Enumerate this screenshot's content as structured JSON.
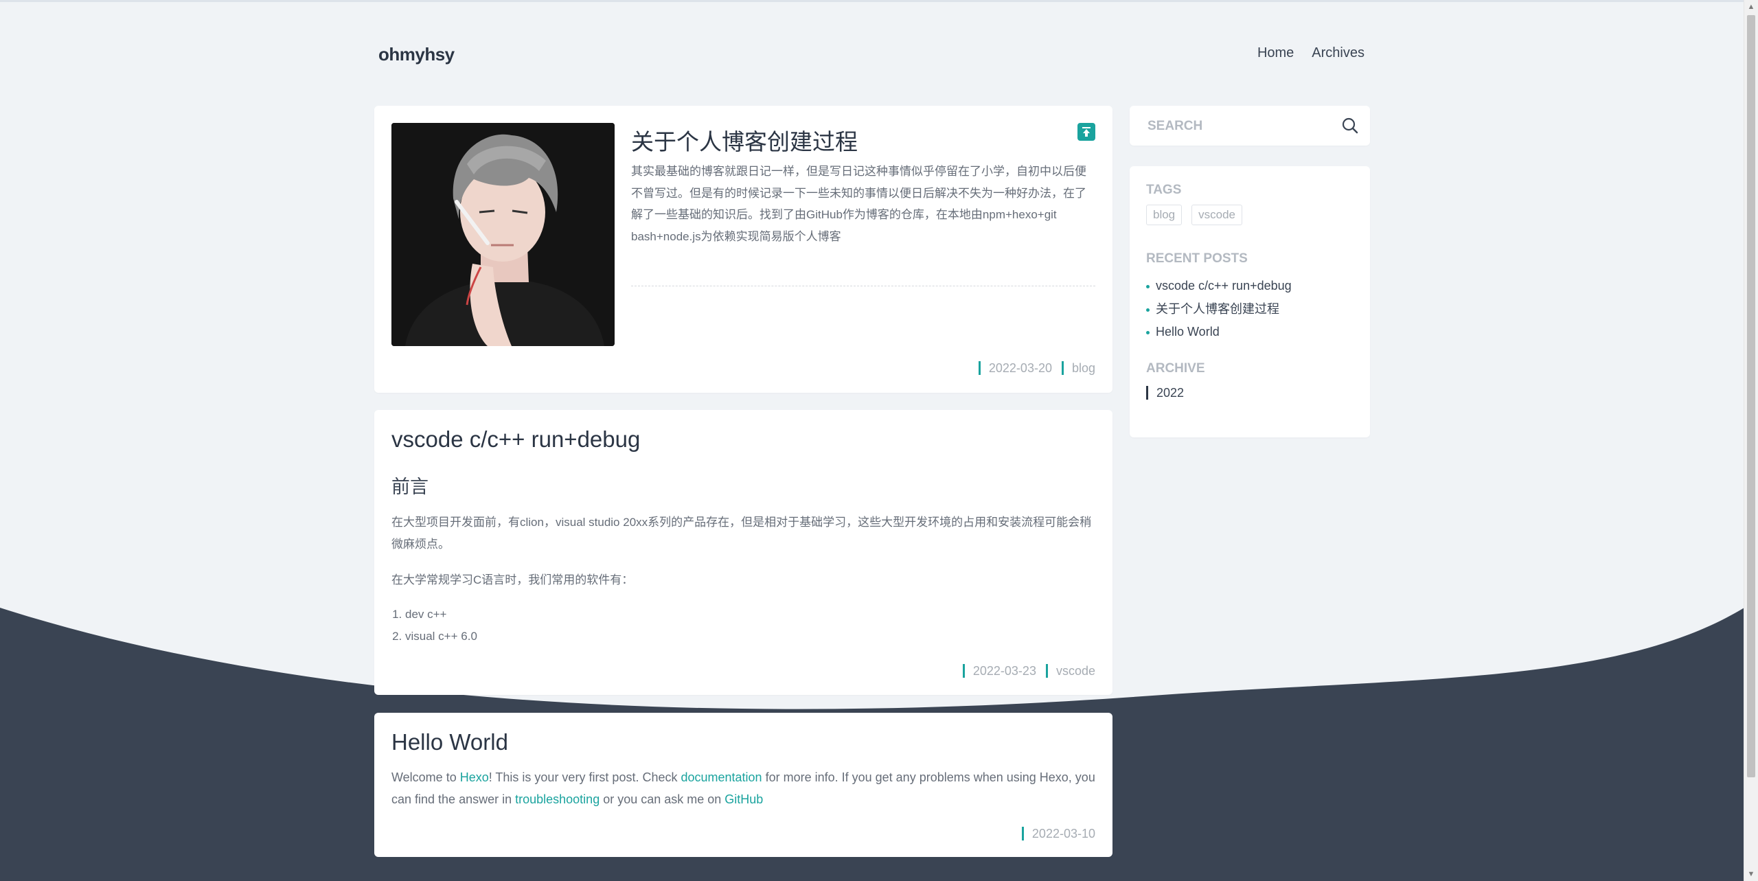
{
  "site": {
    "title": "ohmyhsy"
  },
  "nav": {
    "items": [
      "Home",
      "Archives"
    ]
  },
  "posts": [
    {
      "title": "关于个人博客创建过程",
      "excerpt": "其实最基础的博客就跟日记一样，但是写日记这种事情似乎停留在了小学，自初中以后便不曾写过。但是有的时候记录一下一些未知的事情以便日后解决不失为一种好办法，在了解了一些基础的知识后。找到了由GitHub作为博客的仓库，在本地由npm+hexo+git bash+node.js为依赖实现简易版个人博客",
      "date": "2022-03-20",
      "category": "blog"
    },
    {
      "title": "vscode c/c++ run+debug",
      "heading": "前言",
      "para1": "在大型项目开发面前，有clion，visual studio 20xx系列的产品存在，但是相对于基础学习，这些大型开发环境的占用和安装流程可能会稍微麻烦点。",
      "para2": "在大学常规学习C语言时，我们常用的软件有：",
      "list": [
        "dev c++",
        "visual c++ 6.0"
      ],
      "date": "2022-03-23",
      "category": "vscode"
    },
    {
      "title": "Hello World",
      "t1": "Welcome to ",
      "l1": "Hexo",
      "t2": "! This is your very first post. Check ",
      "l2": "documentation",
      "t3": " for more info. If you get any problems when using Hexo, you can find the answer in ",
      "l3": "troubleshooting",
      "t4": " or you can ask me on ",
      "l4": "GitHub",
      "date": "2022-03-10"
    }
  ],
  "sidebar": {
    "search_placeholder": "SEARCH",
    "tags_title": "TAGS",
    "tags": [
      "blog",
      "vscode"
    ],
    "recent_title": "RECENT POSTS",
    "recent": [
      "vscode c/c++ run+debug",
      "关于个人博客创建过程",
      "Hello World"
    ],
    "archive_title": "ARCHIVE",
    "archive": [
      "2022"
    ]
  },
  "colors": {
    "accent": "#1aa39e",
    "dark": "#3a4453",
    "bg": "#f0f3f6"
  }
}
